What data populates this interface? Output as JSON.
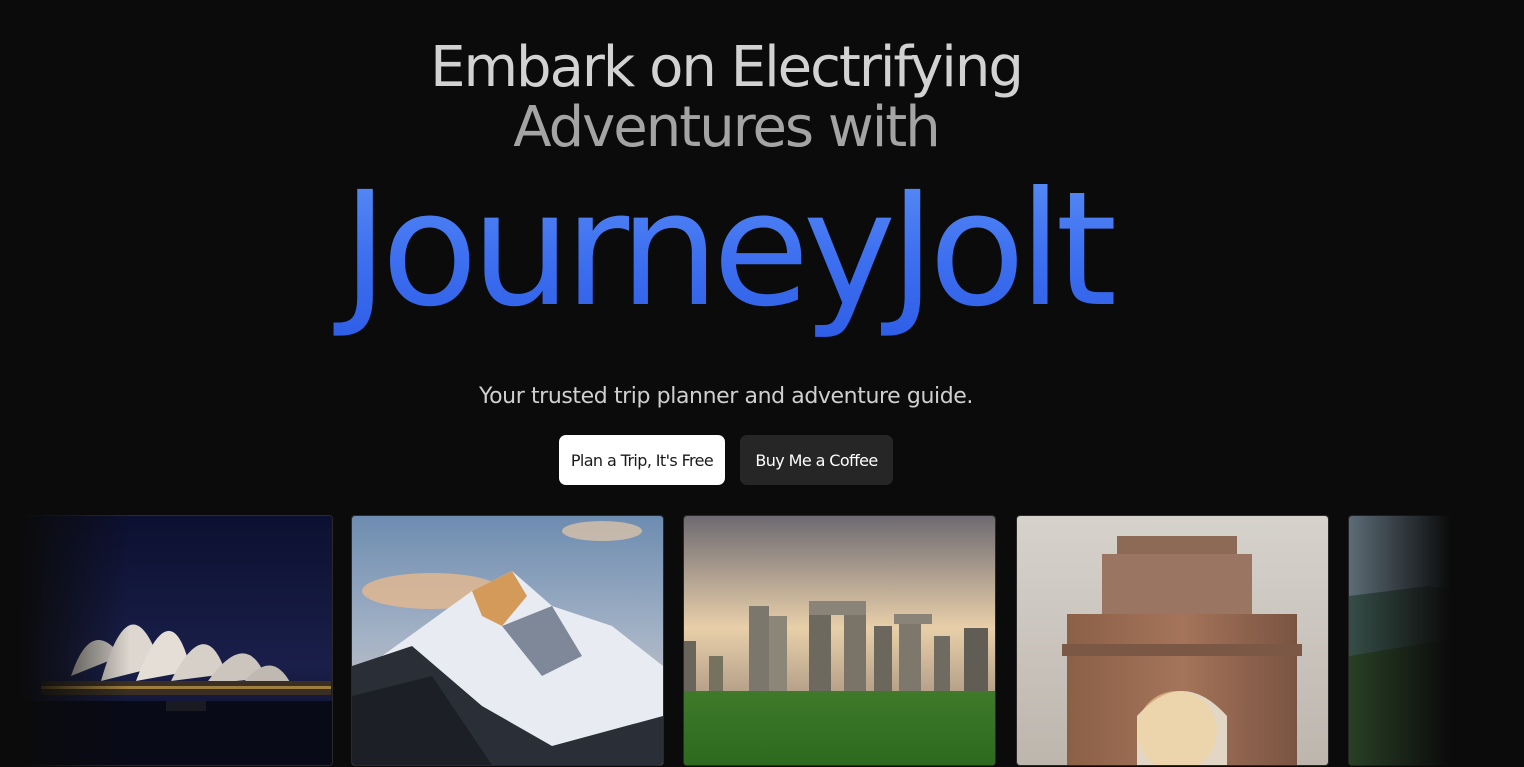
{
  "hero": {
    "headline_line1": "Embark on Electrifying",
    "headline_line2": "Adventures with",
    "brand": "JourneyJolt",
    "tagline": "Your trusted trip planner and adventure guide."
  },
  "actions": {
    "primary_label": "Plan a Trip, It's Free",
    "secondary_label": "Buy Me a Coffee"
  },
  "colors": {
    "background": "#0b0b0b",
    "brand_gradient_top": "#5a8ff5",
    "brand_gradient_bottom": "#2e5ee6",
    "primary_button": "#ffffff",
    "secondary_button": "#262626"
  },
  "gallery": {
    "images": [
      {
        "subject": "sydney-opera-house-night"
      },
      {
        "subject": "snowy-mountain-peak"
      },
      {
        "subject": "stonehenge"
      },
      {
        "subject": "india-gate"
      },
      {
        "subject": "green-valley"
      }
    ]
  }
}
